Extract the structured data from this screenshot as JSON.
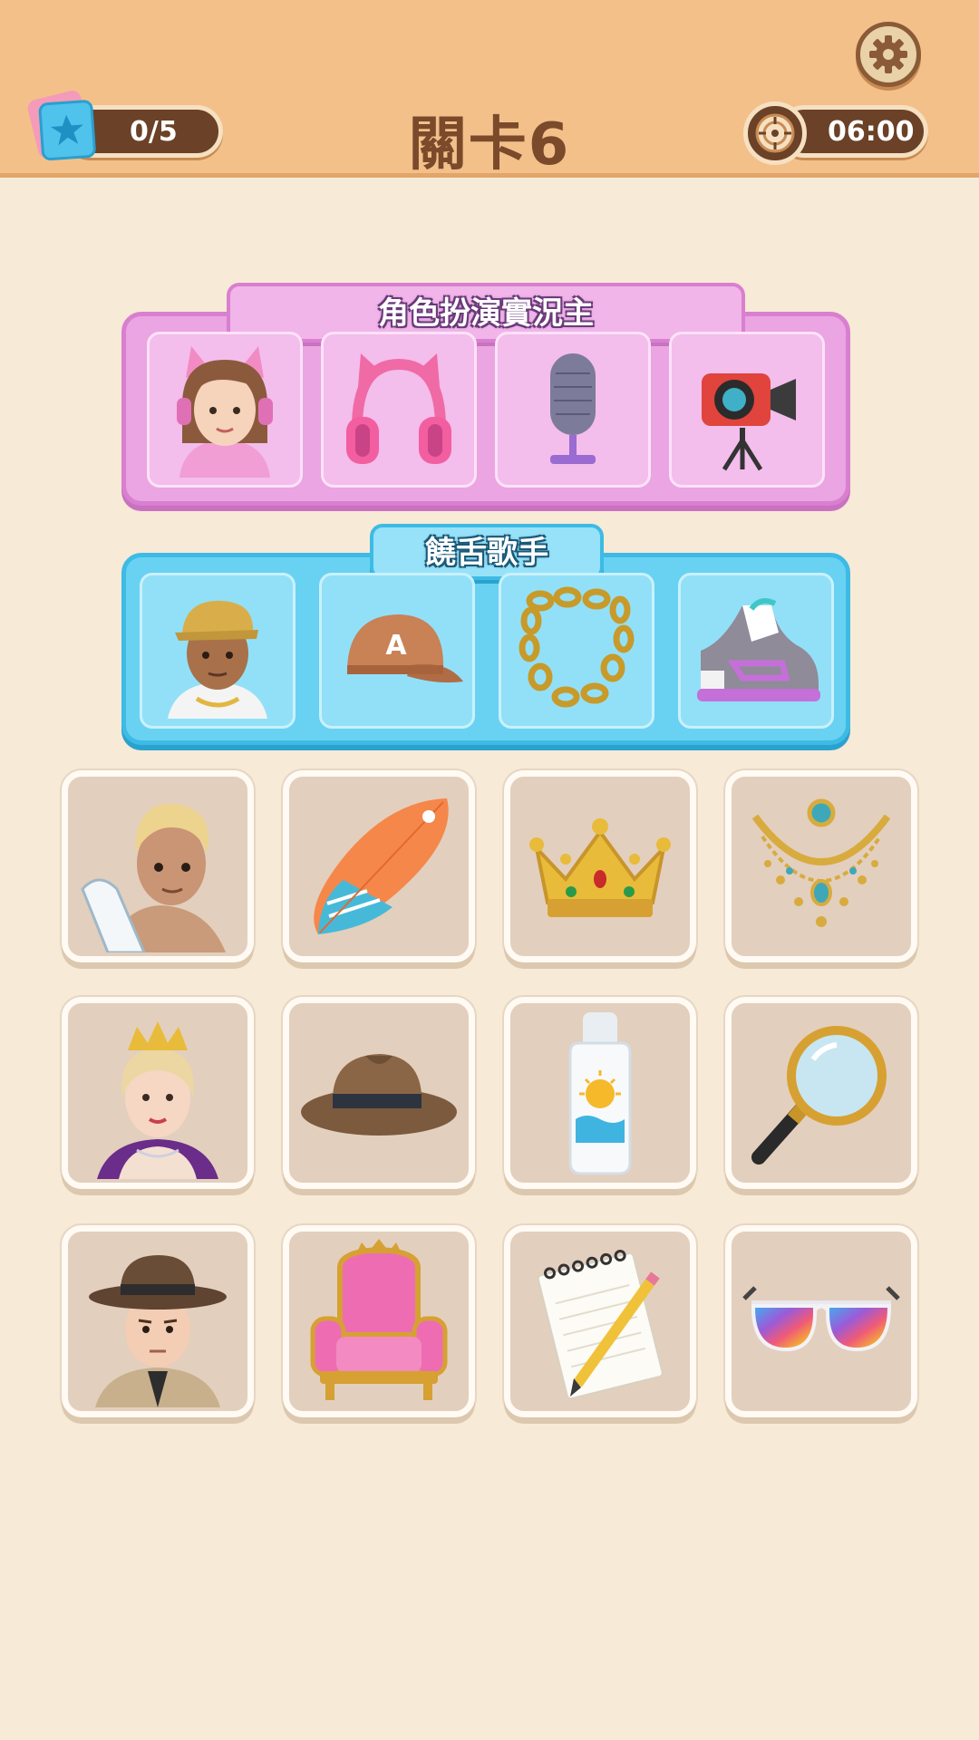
{
  "header": {
    "stars_progress": "0/5",
    "level_title": "關卡6",
    "timer": "06:00",
    "icons": {
      "settings": "gear-icon",
      "stars": "star-icon",
      "timer": "compass-timer-icon"
    }
  },
  "categories": [
    {
      "title": "角色扮演實況主",
      "color": "#eaa5e2",
      "items": [
        "streamer-girl-icon",
        "cat-ear-headphones-icon",
        "microphone-icon",
        "video-camera-icon"
      ]
    },
    {
      "title": "饒舌歌手",
      "color": "#69d2f3",
      "items": [
        "rapper-icon",
        "baseball-cap-icon",
        "gold-chain-icon",
        "sneaker-icon"
      ]
    }
  ],
  "grid": {
    "rows": [
      [
        "surfer-icon",
        "surfboard-icon",
        "crown-icon",
        "jeweled-necklace-icon"
      ],
      [
        "queen-icon",
        "fedora-hat-icon",
        "sunscreen-icon",
        "magnifying-glass-icon"
      ],
      [
        "detective-icon",
        "throne-chair-icon",
        "notepad-pencil-icon",
        "rainbow-sunglasses-icon"
      ]
    ]
  }
}
